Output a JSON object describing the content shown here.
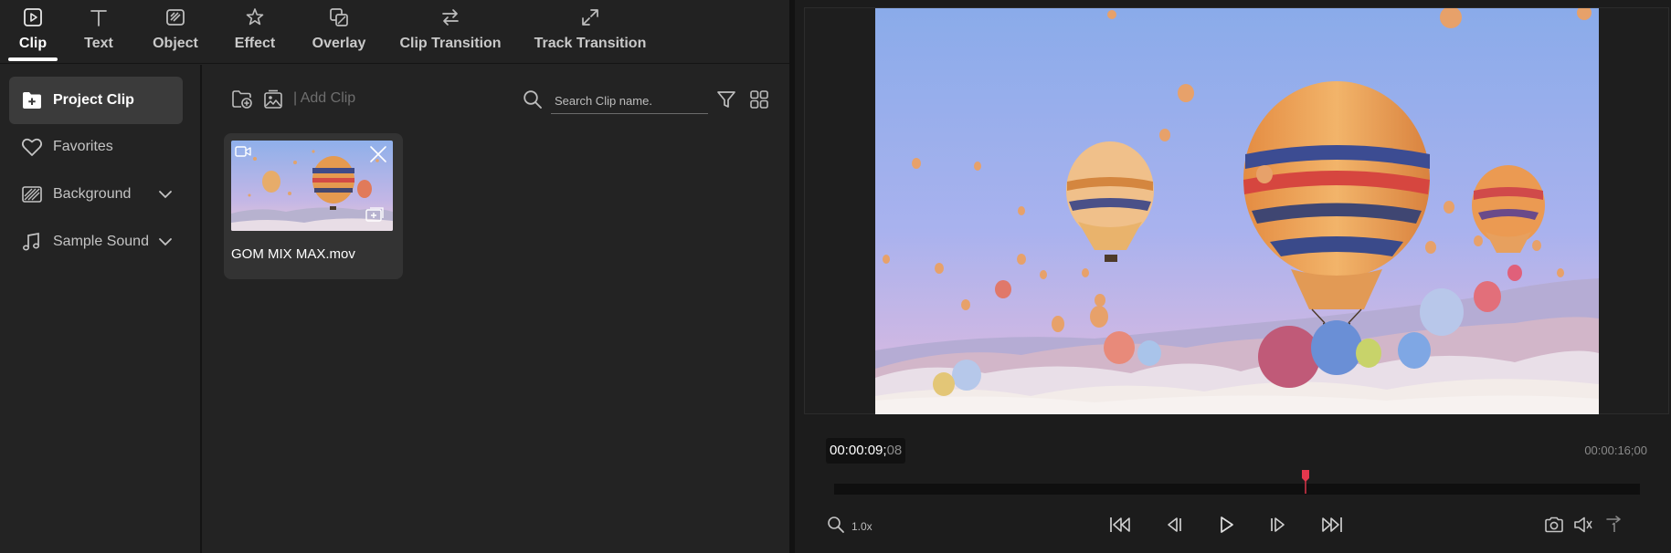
{
  "tabs": [
    {
      "id": "clip",
      "label": "Clip",
      "icon": "clip-icon",
      "active": true
    },
    {
      "id": "text",
      "label": "Text",
      "icon": "text-icon"
    },
    {
      "id": "object",
      "label": "Object",
      "icon": "object-icon"
    },
    {
      "id": "effect",
      "label": "Effect",
      "icon": "effect-icon"
    },
    {
      "id": "overlay",
      "label": "Overlay",
      "icon": "overlay-icon"
    },
    {
      "id": "clip_transition",
      "label": "Clip Transition",
      "icon": "clip-transition-icon"
    },
    {
      "id": "track_transition",
      "label": "Track Transition",
      "icon": "track-transition-icon"
    }
  ],
  "sidebar": {
    "items": [
      {
        "label": "Project Clip",
        "icon": "project-clip-icon",
        "active": true
      },
      {
        "label": "Favorites",
        "icon": "heart-icon"
      },
      {
        "label": "Background",
        "icon": "background-pattern-icon",
        "expandable": true
      },
      {
        "label": "Sample Sound",
        "icon": "music-note-icon",
        "expandable": true
      }
    ]
  },
  "toolbar": {
    "add_clip_label": "| Add Clip",
    "search_placeholder": "Search Clip name.",
    "icons": [
      "add-folder-icon",
      "add-image-icon",
      "search-icon",
      "filter-icon",
      "grid-view-icon"
    ]
  },
  "clips": [
    {
      "name": "GOM MIX MAX.mov",
      "type_icon": "video-icon",
      "overlay_icons": [
        "close-icon",
        "add-to-timeline-icon"
      ]
    }
  ],
  "player": {
    "current_time": "00:00:09;",
    "current_frame": "08",
    "total_time": "00:00:16;00",
    "progress": 0.585,
    "zoom": "1.0x",
    "controls": [
      "skip-to-start-icon",
      "previous-frame-icon",
      "play-icon",
      "next-frame-icon",
      "skip-to-end-icon"
    ],
    "right_controls": [
      "snapshot-camera-icon",
      "volume-icon",
      "export-icon"
    ]
  },
  "colors": {
    "accent": "#e5374d",
    "panel": "#232323",
    "active_item": "#3b3b3b"
  }
}
